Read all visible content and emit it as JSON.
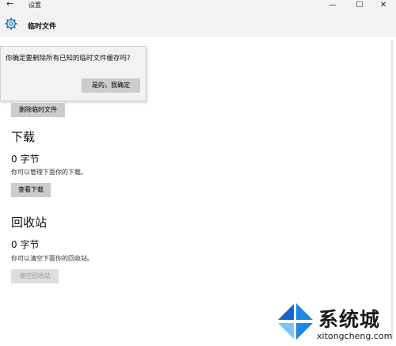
{
  "titlebar": {
    "back_icon": "back-arrow-icon",
    "title": "设置",
    "minimize": "—",
    "maximize": "☐",
    "close": "✕"
  },
  "header": {
    "icon": "gear-icon",
    "title": "临时文件"
  },
  "flyout": {
    "message": "你确定要删除所有已知的临时文件缓存吗?",
    "confirm_label": "是的，我确定"
  },
  "temp": {
    "delete_label": "删除临时文件"
  },
  "downloads": {
    "title": "下载",
    "size": "0 字节",
    "description": "你可以管理下面你的下载。",
    "button_label": "查看下载"
  },
  "recycle": {
    "title": "回收站",
    "size": "0 字节",
    "description": "你可以清空下面你的回收站。",
    "button_label": "清空回收站"
  },
  "watermark": {
    "text": "系统城",
    "url": "xitongcheng.com",
    "colors": {
      "blue": "#1e88e5",
      "light_blue": "#7cc5f4"
    }
  }
}
